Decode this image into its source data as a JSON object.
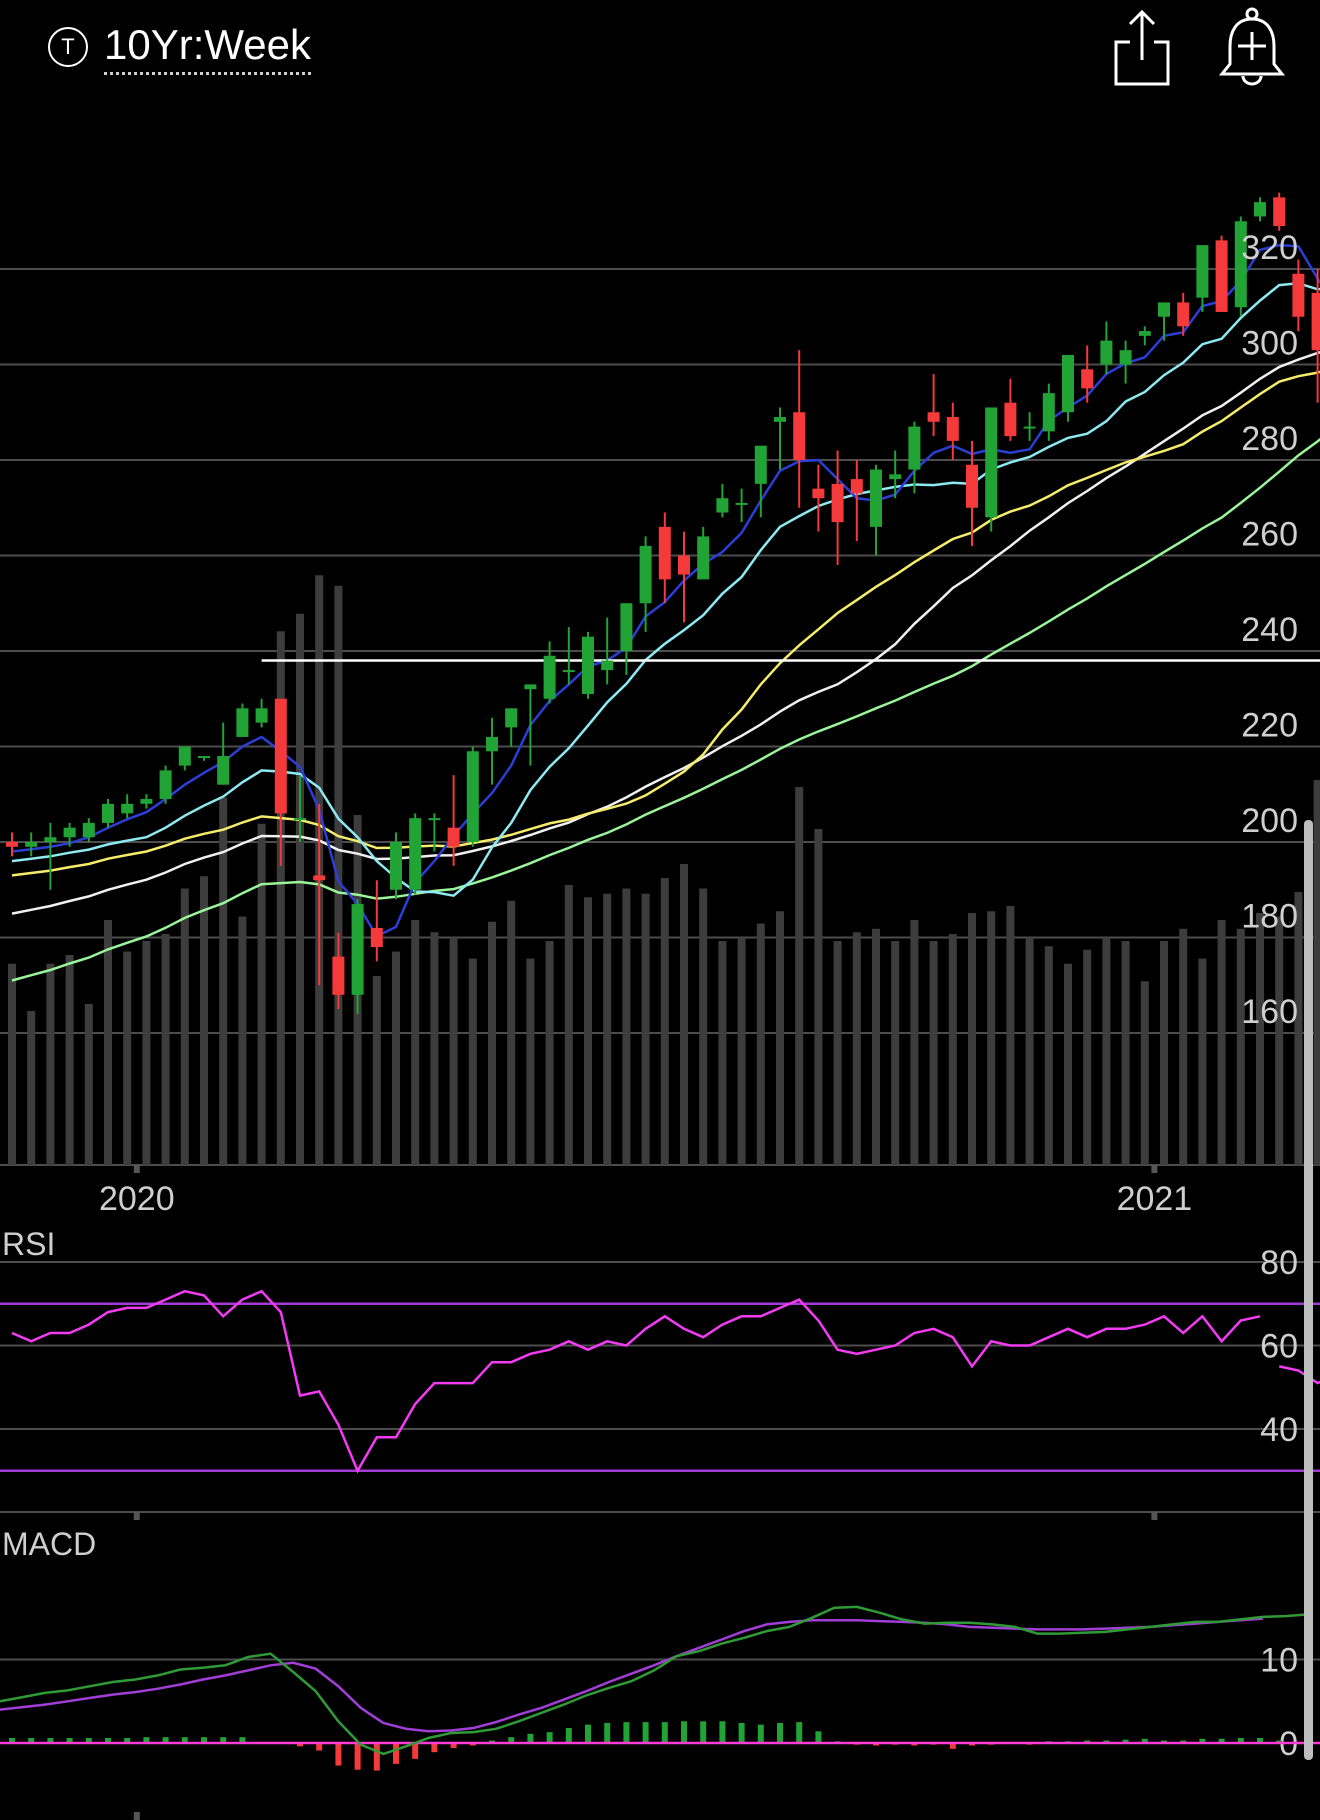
{
  "header": {
    "symbol_badge": "T",
    "title": "10Yr:Week",
    "share_icon": "share-icon",
    "alert_icon": "add-alert-bell-icon"
  },
  "colors": {
    "background": "#000000",
    "up_candle": "#22a335",
    "down_candle": "#f43a3a",
    "sma_fast": "#2b3fd6",
    "sma_cyan": "#8de9f2",
    "sma_yellow": "#f5ec6a",
    "sma_white": "#f0f0f0",
    "sma_green": "#9af59a",
    "resistance_line": "#ffffff",
    "rsi_line": "#f23bf2",
    "rsi_band": "#a53bd6",
    "macd_line": "#2f9a36",
    "macd_signal": "#a03ed6",
    "macd_zero": "#ff3ad6",
    "grid": "#4d4d4d",
    "volume": "#3d3d3d"
  },
  "chart_data": [
    {
      "panel": "price",
      "type": "candlestick",
      "ylim": [
        145,
        350
      ],
      "y_ticks": [
        160,
        180,
        200,
        220,
        240,
        260,
        280,
        300,
        320
      ],
      "x_ticks": [
        "2020",
        "2021"
      ],
      "x_tick_index": [
        6.5,
        59.5
      ],
      "resistance_level": 238,
      "resistance_start_index": 13,
      "ohlc": [
        [
          200,
          202,
          197,
          199
        ],
        [
          199,
          202,
          197,
          200
        ],
        [
          200,
          204,
          190,
          201
        ],
        [
          201,
          204,
          199,
          203
        ],
        [
          201,
          205,
          200,
          204
        ],
        [
          204,
          209,
          203,
          208
        ],
        [
          206,
          210,
          205,
          208
        ],
        [
          208,
          210,
          207,
          209
        ],
        [
          209,
          216,
          208,
          215
        ],
        [
          216,
          220,
          215,
          220
        ],
        [
          218,
          218,
          217,
          218
        ],
        [
          212,
          225,
          212,
          218
        ],
        [
          222,
          229,
          222,
          228
        ],
        [
          225,
          230,
          224,
          228
        ],
        [
          230,
          225,
          195,
          206
        ],
        [
          205,
          214,
          200,
          205
        ],
        [
          193,
          208,
          170,
          192
        ],
        [
          176,
          181,
          165,
          168
        ],
        [
          168,
          188,
          164,
          187
        ],
        [
          182,
          192,
          175,
          178
        ],
        [
          190,
          202,
          188,
          200
        ],
        [
          190,
          206,
          189,
          205
        ],
        [
          205,
          206,
          198,
          205
        ],
        [
          203,
          214,
          195,
          199
        ],
        [
          200,
          220,
          199,
          219
        ],
        [
          219,
          226,
          212,
          222
        ],
        [
          224,
          228,
          220,
          228
        ],
        [
          232,
          233,
          216,
          233
        ],
        [
          230,
          242,
          229,
          239
        ],
        [
          236,
          245,
          233,
          236
        ],
        [
          231,
          244,
          230,
          243
        ],
        [
          236,
          247,
          233,
          238
        ],
        [
          240,
          250,
          235,
          250
        ],
        [
          250,
          264,
          244,
          262
        ],
        [
          266,
          269,
          250,
          255
        ],
        [
          260,
          265,
          246,
          256
        ],
        [
          255,
          266,
          255,
          264
        ],
        [
          269,
          275,
          268,
          272
        ],
        [
          271,
          274,
          267,
          271
        ],
        [
          275,
          280,
          268,
          283
        ],
        [
          288,
          291,
          278,
          289
        ],
        [
          290,
          303,
          270,
          280
        ],
        [
          274,
          279,
          265,
          272
        ],
        [
          275,
          282,
          258,
          267
        ],
        [
          276,
          280,
          263,
          273
        ],
        [
          266,
          279,
          260,
          278
        ],
        [
          276,
          282,
          272,
          277
        ],
        [
          278,
          288,
          273,
          287
        ],
        [
          290,
          298,
          285,
          288
        ],
        [
          289,
          292,
          280,
          284
        ],
        [
          279,
          284,
          262,
          270
        ],
        [
          268,
          291,
          265,
          291
        ],
        [
          292,
          297,
          284,
          285
        ],
        [
          287,
          290,
          284,
          287
        ],
        [
          286,
          296,
          284,
          294
        ],
        [
          290,
          302,
          288,
          302
        ],
        [
          299,
          304,
          292,
          295
        ],
        [
          300,
          309,
          298,
          305
        ],
        [
          300,
          305,
          296,
          303
        ],
        [
          306,
          308,
          304,
          307
        ],
        [
          310,
          311,
          305,
          313
        ],
        [
          313,
          315,
          306,
          308
        ],
        [
          314,
          322,
          311,
          325
        ],
        [
          326,
          327,
          312,
          311
        ],
        [
          312,
          331,
          310,
          330
        ],
        [
          331,
          335,
          330,
          334
        ],
        [
          335,
          336,
          328,
          329
        ],
        [
          319,
          322,
          307,
          310
        ],
        [
          315,
          320,
          292,
          303
        ],
        [
          306,
          318,
          305,
          310
        ]
      ],
      "volume": [
        115,
        88,
        115,
        120,
        92,
        140,
        122,
        128,
        132,
        158,
        165,
        210,
        142,
        195,
        305,
        315,
        337,
        331,
        200,
        108,
        122,
        140,
        133,
        130,
        118,
        139,
        151,
        118,
        128,
        160,
        153,
        155,
        158,
        155,
        164,
        172,
        158,
        128,
        130,
        138,
        145,
        216,
        192,
        128,
        133,
        135,
        128,
        140,
        128,
        132,
        144,
        145,
        148,
        130,
        125,
        115,
        123,
        130,
        128,
        105,
        128,
        135,
        118,
        140,
        135,
        144,
        142,
        156,
        220,
        240
      ]
    },
    {
      "panel": "RSI",
      "type": "line",
      "label": "RSI",
      "ylim": [
        22,
        88
      ],
      "y_ticks": [
        40,
        60,
        80
      ],
      "bands": [
        30,
        70
      ],
      "values": [
        63,
        61,
        63,
        63,
        65,
        68,
        69,
        69,
        71,
        73,
        72,
        67,
        71,
        73,
        68,
        48,
        49,
        41,
        30,
        38,
        38,
        46,
        51,
        51,
        51,
        56,
        56,
        58,
        59,
        61,
        59,
        61,
        60,
        64,
        67,
        64,
        62,
        65,
        67,
        67,
        69,
        71,
        66,
        59,
        58,
        59,
        60,
        63,
        64,
        62,
        55,
        61,
        60,
        60,
        62,
        64,
        62,
        64,
        64,
        65,
        67,
        63,
        67,
        61,
        66,
        67,
        55,
        54,
        51,
        53
      ],
      "rsi_break_index": 65
    },
    {
      "panel": "MACD",
      "type": "line+histogram",
      "label": "MACD",
      "ylim": [
        -3.5,
        20
      ],
      "y_ticks": [
        0,
        10
      ],
      "macd": [
        5,
        5.5,
        6,
        6.3,
        6.8,
        7.3,
        7.6,
        8.1,
        8.8,
        9,
        9.3,
        10.3,
        10.7,
        8.5,
        6.2,
        2.6,
        -0.2,
        -1.3,
        -0.4,
        0.6,
        1.2,
        1.3,
        1.7,
        2.6,
        3.6,
        4.6,
        5.7,
        6.6,
        7.4,
        8.7,
        10.4,
        11,
        11.9,
        12.6,
        13.4,
        13.9,
        15,
        16.2,
        16.3,
        15.6,
        14.8,
        14.3,
        14.4,
        14.4,
        14.2,
        13.9,
        13.1,
        13.1,
        13.2,
        13.3,
        13.6,
        13.9,
        14.2,
        14.5,
        14.5,
        14.8,
        15.1,
        15.2,
        15.4
      ],
      "signal": [
        4,
        4.3,
        4.6,
        5,
        5.4,
        5.8,
        6.1,
        6.5,
        7,
        7.6,
        8.1,
        8.7,
        9.3,
        9.6,
        8.9,
        6.8,
        4.2,
        2.4,
        1.7,
        1.4,
        1.5,
        1.8,
        2.5,
        3.4,
        4.2,
        5.2,
        6.2,
        7.3,
        8.3,
        9.3,
        10.4,
        11.4,
        12.4,
        13.4,
        14.2,
        14.5,
        14.7,
        14.7,
        14.7,
        14.6,
        14.5,
        14.4,
        14.2,
        13.9,
        13.8,
        13.7,
        13.6,
        13.6,
        13.6,
        13.7,
        13.8,
        13.9,
        14.1,
        14.3,
        14.5,
        14.7,
        14.9
      ],
      "histogram": [
        0.6,
        0.6,
        0.6,
        0.6,
        0.6,
        0.6,
        0.6,
        0.7,
        0.7,
        0.7,
        0.7,
        0.7,
        0.7,
        0,
        0,
        -0.4,
        -0.9,
        -2.7,
        -3.2,
        -3.3,
        -2.5,
        -1.9,
        -1.1,
        -0.6,
        -0.3,
        0.3,
        0.7,
        1.1,
        1.3,
        1.8,
        2.2,
        2.4,
        2.5,
        2.5,
        2.5,
        2.6,
        2.6,
        2.6,
        2.4,
        2.2,
        2.4,
        2.5,
        1.4,
        0.2,
        -0.2,
        -0.3,
        -0.2,
        -0.3,
        -0.2,
        -0.7,
        -0.3,
        -0.2,
        -0.1,
        -0.2,
        0.2,
        0.2,
        0.3,
        0.3,
        0.4,
        0.5,
        0.3,
        0.3,
        0.5,
        0.5,
        0.6,
        0.6,
        0.3
      ]
    }
  ]
}
